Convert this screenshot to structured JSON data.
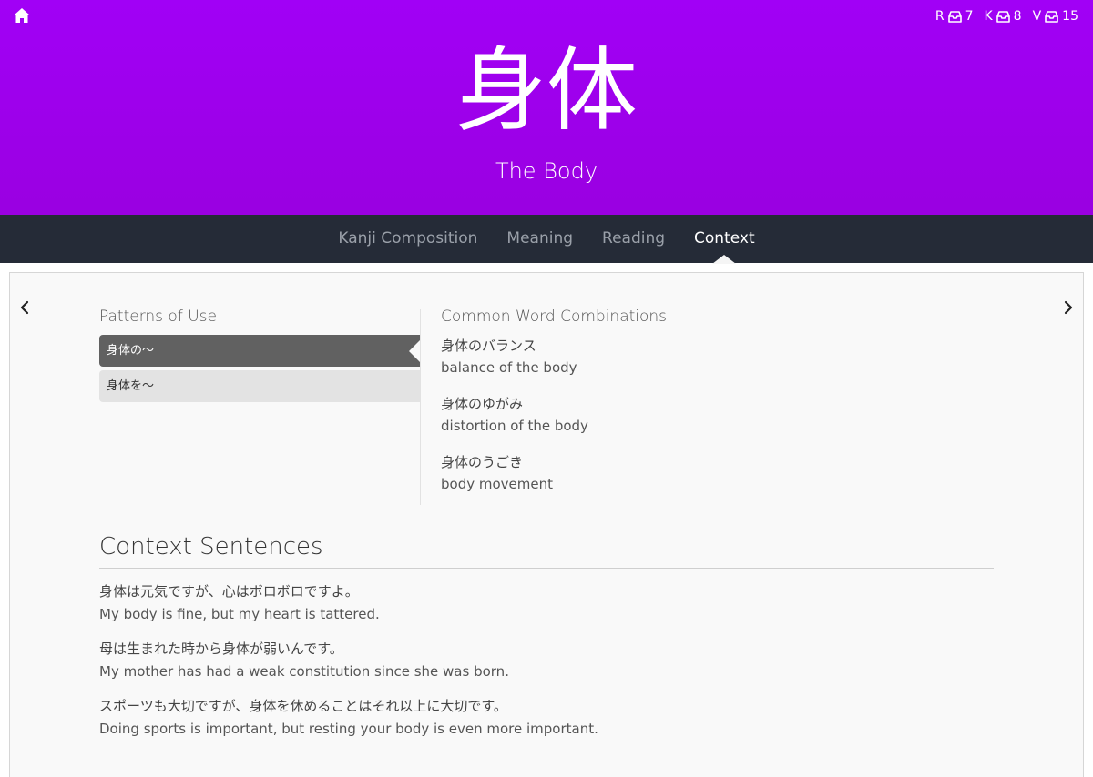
{
  "header": {
    "kanji": "身体",
    "meaning": "The Body",
    "queue": [
      {
        "letter": "R",
        "count": "7"
      },
      {
        "letter": "K",
        "count": "8"
      },
      {
        "letter": "V",
        "count": "15"
      }
    ],
    "background_color": "#9f00f0"
  },
  "nav": {
    "tabs": [
      {
        "label": "Kanji Composition"
      },
      {
        "label": "Meaning"
      },
      {
        "label": "Reading"
      },
      {
        "label": "Context"
      }
    ],
    "active_tab": "Context",
    "background_color": "#252b37"
  },
  "patterns": {
    "label": "Patterns of Use",
    "items": [
      {
        "label": "身体の〜",
        "active": true
      },
      {
        "label": "身体を〜",
        "active": false
      }
    ]
  },
  "combinations": {
    "label": "Common Word Combinations",
    "items": [
      {
        "ja": "身体のバランス",
        "en": "balance of the body"
      },
      {
        "ja": "身体のゆがみ",
        "en": "distortion of the body"
      },
      {
        "ja": "身体のうごき",
        "en": "body movement"
      }
    ]
  },
  "sentences": {
    "title": "Context Sentences",
    "items": [
      {
        "ja": "身体は元気ですが、心はボロボロですよ。",
        "en": "My body is fine, but my heart is tattered."
      },
      {
        "ja": "母は生まれた時から身体が弱いんです。",
        "en": "My mother has had a weak constitution since she was born."
      },
      {
        "ja": "スポーツも大切ですが、身体を休めることはそれ以上に大切です。",
        "en": "Doing sports is important, but resting your body is even more important."
      }
    ]
  },
  "icons": {
    "home": "home-icon",
    "inbox": "inbox-icon",
    "prev": "chevron-left-icon",
    "next": "chevron-right-icon"
  }
}
